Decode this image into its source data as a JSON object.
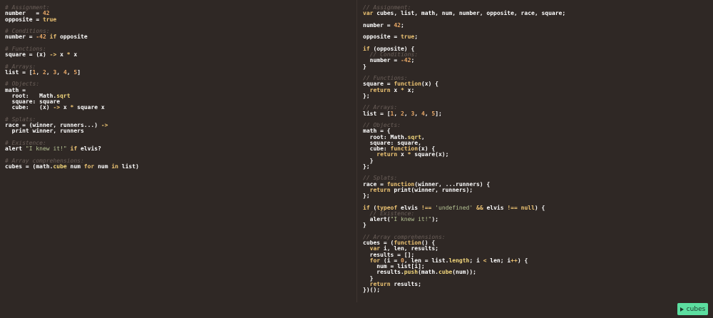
{
  "coffee": [
    [
      [
        "c",
        "# Assignment:"
      ]
    ],
    [
      [
        "p",
        "number   = "
      ],
      [
        "n",
        "42"
      ]
    ],
    [
      [
        "p",
        "opposite = "
      ],
      [
        "k",
        "true"
      ]
    ],
    [],
    [
      [
        "c",
        "# Conditions:"
      ]
    ],
    [
      [
        "p",
        "number = "
      ],
      [
        "n",
        "-42"
      ],
      [
        "p",
        " "
      ],
      [
        "k",
        "if"
      ],
      [
        "p",
        " opposite"
      ]
    ],
    [],
    [
      [
        "c",
        "# Functions:"
      ]
    ],
    [
      [
        "p",
        "square = (x) "
      ],
      [
        "k",
        "->"
      ],
      [
        "p",
        " x "
      ],
      [
        "k",
        "*"
      ],
      [
        "p",
        " x"
      ]
    ],
    [],
    [
      [
        "c",
        "# Arrays:"
      ]
    ],
    [
      [
        "p",
        "list = ["
      ],
      [
        "n",
        "1"
      ],
      [
        "p",
        ", "
      ],
      [
        "n",
        "2"
      ],
      [
        "p",
        ", "
      ],
      [
        "n",
        "3"
      ],
      [
        "p",
        ", "
      ],
      [
        "n",
        "4"
      ],
      [
        "p",
        ", "
      ],
      [
        "n",
        "5"
      ],
      [
        "p",
        "]"
      ]
    ],
    [],
    [
      [
        "c",
        "# Objects:"
      ]
    ],
    [
      [
        "p",
        "math ="
      ]
    ],
    [
      [
        "p",
        "  root:   Math."
      ],
      [
        "f",
        "sqrt"
      ]
    ],
    [
      [
        "p",
        "  square: square"
      ]
    ],
    [
      [
        "p",
        "  cube:   (x) "
      ],
      [
        "k",
        "->"
      ],
      [
        "p",
        " x "
      ],
      [
        "k",
        "*"
      ],
      [
        "p",
        " square x"
      ]
    ],
    [],
    [
      [
        "c",
        "# Splats:"
      ]
    ],
    [
      [
        "p",
        "race = (winner, runners...) "
      ],
      [
        "k",
        "->"
      ]
    ],
    [
      [
        "p",
        "  print winner, runners"
      ]
    ],
    [],
    [
      [
        "c",
        "# Existence:"
      ]
    ],
    [
      [
        "p",
        "alert "
      ],
      [
        "s",
        "\"I knew it!\""
      ],
      [
        "p",
        " "
      ],
      [
        "k",
        "if"
      ],
      [
        "p",
        " elvis?"
      ]
    ],
    [],
    [
      [
        "c",
        "# Array comprehensions:"
      ]
    ],
    [
      [
        "p",
        "cubes = (math."
      ],
      [
        "f",
        "cube"
      ],
      [
        "p",
        " num "
      ],
      [
        "k",
        "for"
      ],
      [
        "p",
        " num "
      ],
      [
        "k",
        "in"
      ],
      [
        "p",
        " list)"
      ]
    ]
  ],
  "js": [
    [
      [
        "c",
        "// Assignment:"
      ]
    ],
    [
      [
        "k",
        "var"
      ],
      [
        "p",
        " cubes, list, math, num, number, opposite, race, square;"
      ]
    ],
    [],
    [
      [
        "p",
        "number = "
      ],
      [
        "n",
        "42"
      ],
      [
        "p",
        ";"
      ]
    ],
    [],
    [
      [
        "p",
        "opposite = "
      ],
      [
        "k",
        "true"
      ],
      [
        "p",
        ";"
      ]
    ],
    [],
    [
      [
        "k",
        "if"
      ],
      [
        "p",
        " (opposite) {"
      ]
    ],
    [
      [
        "c",
        "  // Conditions:"
      ]
    ],
    [
      [
        "p",
        "  number = "
      ],
      [
        "n",
        "-42"
      ],
      [
        "p",
        ";"
      ]
    ],
    [
      [
        "p",
        "}"
      ]
    ],
    [],
    [
      [
        "c",
        "// Functions:"
      ]
    ],
    [
      [
        "p",
        "square = "
      ],
      [
        "k",
        "function"
      ],
      [
        "p",
        "(x) {"
      ]
    ],
    [
      [
        "k",
        "  return"
      ],
      [
        "p",
        " x "
      ],
      [
        "k",
        "*"
      ],
      [
        "p",
        " x;"
      ]
    ],
    [
      [
        "p",
        "};"
      ]
    ],
    [],
    [
      [
        "c",
        "// Arrays:"
      ]
    ],
    [
      [
        "p",
        "list = ["
      ],
      [
        "n",
        "1"
      ],
      [
        "p",
        ", "
      ],
      [
        "n",
        "2"
      ],
      [
        "p",
        ", "
      ],
      [
        "n",
        "3"
      ],
      [
        "p",
        ", "
      ],
      [
        "n",
        "4"
      ],
      [
        "p",
        ", "
      ],
      [
        "n",
        "5"
      ],
      [
        "p",
        "];"
      ]
    ],
    [],
    [
      [
        "c",
        "// Objects:"
      ]
    ],
    [
      [
        "p",
        "math = {"
      ]
    ],
    [
      [
        "p",
        "  root: Math."
      ],
      [
        "f",
        "sqrt"
      ],
      [
        "p",
        ","
      ]
    ],
    [
      [
        "p",
        "  square: square,"
      ]
    ],
    [
      [
        "p",
        "  cube: "
      ],
      [
        "k",
        "function"
      ],
      [
        "p",
        "(x) {"
      ]
    ],
    [
      [
        "k",
        "    return"
      ],
      [
        "p",
        " x "
      ],
      [
        "k",
        "*"
      ],
      [
        "p",
        " square(x);"
      ]
    ],
    [
      [
        "p",
        "  }"
      ]
    ],
    [
      [
        "p",
        "};"
      ]
    ],
    [],
    [
      [
        "c",
        "// Splats:"
      ]
    ],
    [
      [
        "p",
        "race = "
      ],
      [
        "k",
        "function"
      ],
      [
        "p",
        "(winner, ...runners) {"
      ]
    ],
    [
      [
        "k",
        "  return"
      ],
      [
        "p",
        " print(winner, runners);"
      ]
    ],
    [
      [
        "p",
        "};"
      ]
    ],
    [],
    [
      [
        "k",
        "if"
      ],
      [
        "p",
        " ("
      ],
      [
        "k",
        "typeof"
      ],
      [
        "p",
        " elvis "
      ],
      [
        "k",
        "!=="
      ],
      [
        "p",
        " "
      ],
      [
        "s",
        "'undefined'"
      ],
      [
        "p",
        " "
      ],
      [
        "k",
        "&&"
      ],
      [
        "p",
        " elvis "
      ],
      [
        "k",
        "!=="
      ],
      [
        "p",
        " "
      ],
      [
        "k",
        "null"
      ],
      [
        "p",
        ") {"
      ]
    ],
    [
      [
        "c",
        "  // Existence:"
      ]
    ],
    [
      [
        "p",
        "  alert("
      ],
      [
        "s",
        "\"I knew it!\""
      ],
      [
        "p",
        ");"
      ]
    ],
    [
      [
        "p",
        "}"
      ]
    ],
    [],
    [
      [
        "c",
        "// Array comprehensions:"
      ]
    ],
    [
      [
        "p",
        "cubes = ("
      ],
      [
        "k",
        "function"
      ],
      [
        "p",
        "() {"
      ]
    ],
    [
      [
        "k",
        "  var"
      ],
      [
        "p",
        " i, len, results;"
      ]
    ],
    [
      [
        "p",
        "  results = [];"
      ]
    ],
    [
      [
        "k",
        "  for"
      ],
      [
        "p",
        " (i = "
      ],
      [
        "n",
        "0"
      ],
      [
        "p",
        ", len = list."
      ],
      [
        "f",
        "length"
      ],
      [
        "p",
        "; i "
      ],
      [
        "k",
        "<"
      ],
      [
        "p",
        " len; i"
      ],
      [
        "k",
        "++"
      ],
      [
        "p",
        ") {"
      ]
    ],
    [
      [
        "p",
        "    num = list[i];"
      ]
    ],
    [
      [
        "p",
        "    results."
      ],
      [
        "f",
        "push"
      ],
      [
        "p",
        "(math."
      ],
      [
        "f",
        "cube"
      ],
      [
        "p",
        "(num));"
      ]
    ],
    [
      [
        "p",
        "  }"
      ]
    ],
    [
      [
        "k",
        "  return"
      ],
      [
        "p",
        " results;"
      ]
    ],
    [
      [
        "p",
        "})();"
      ]
    ]
  ],
  "run_button": {
    "label": "cubes",
    "icon": "play-icon"
  }
}
